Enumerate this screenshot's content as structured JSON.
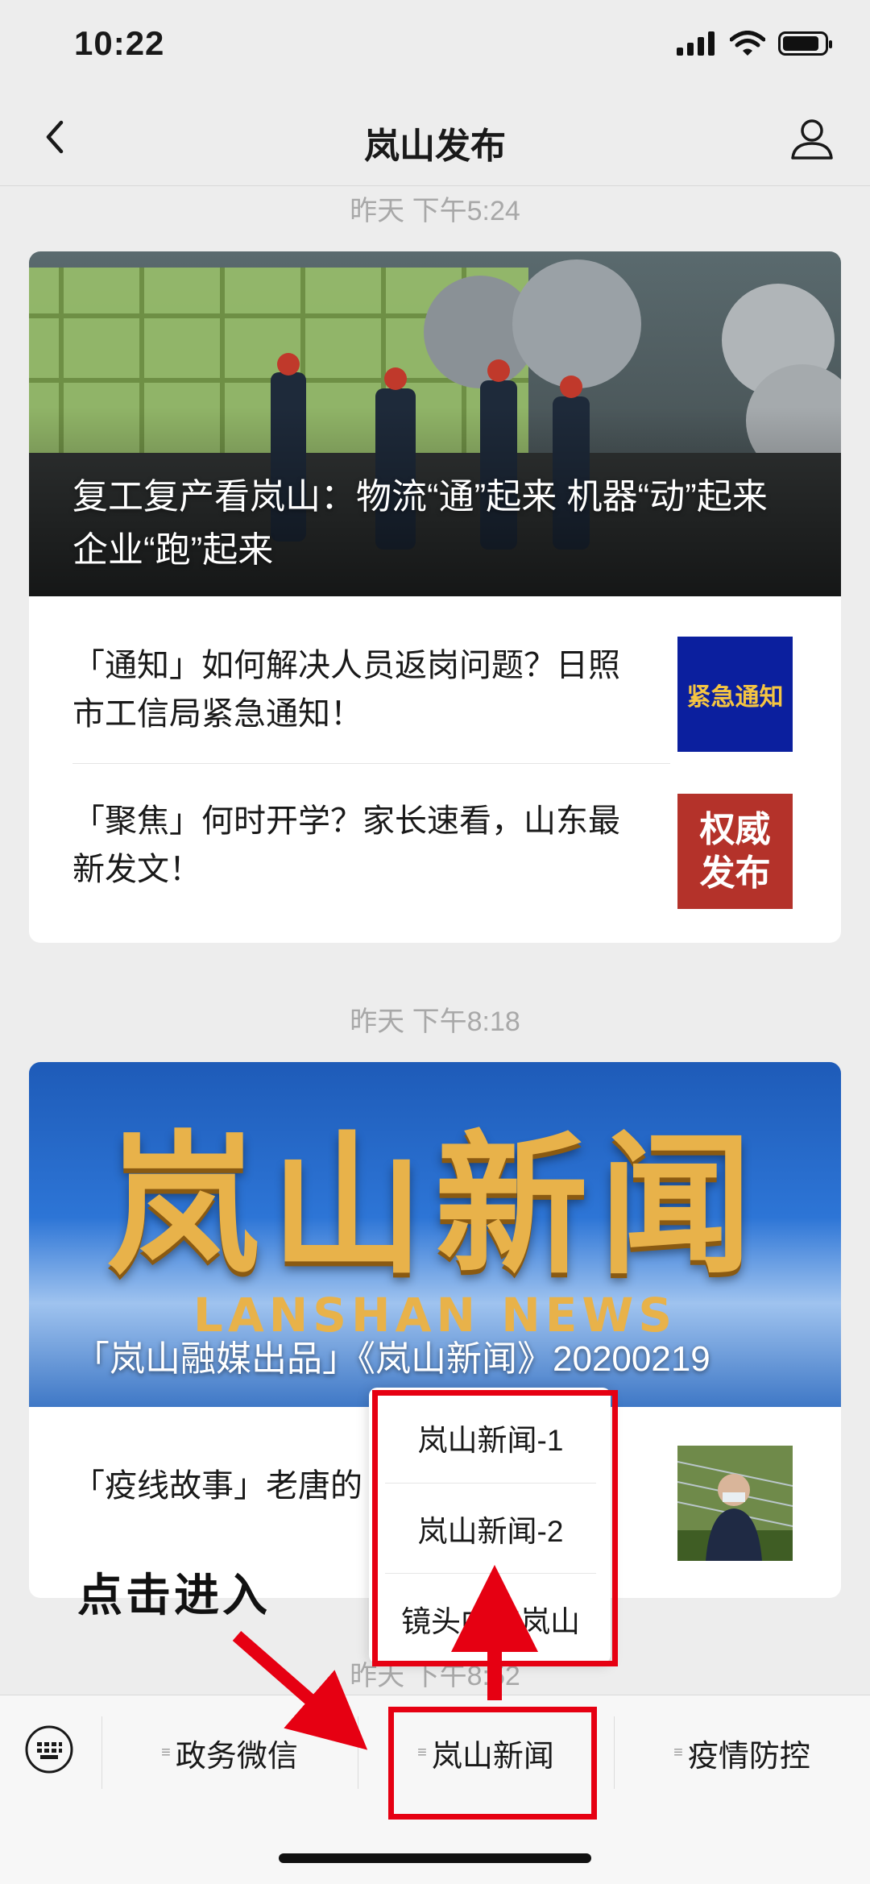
{
  "status": {
    "time": "10:22"
  },
  "nav": {
    "title": "岚山发布"
  },
  "feed": [
    {
      "time": "昨天 下午5:24",
      "hero_title": "复工复产看岚山：物流“通”起来 机器“动”起来 企业“跑”起来",
      "items": [
        {
          "text": "「通知」如何解决人员返岗问题？日照市工信局紧急通知！",
          "thumb_text": "紧急通知",
          "thumb_color": "#0b1f9e"
        },
        {
          "text": "「聚焦」何时开学？家长速看，山东最新发文！",
          "thumb_text": "权威发布",
          "thumb_color": "#b4322a"
        }
      ]
    },
    {
      "time": "昨天 下午8:18",
      "hero_banner_cn": "岚山新闻",
      "hero_banner_en": "LANSHAN NEWS",
      "hero_title": "「岚山融媒出品」《岚山新闻》20200219",
      "items": [
        {
          "text": "「疫线故事」老唐的"
        }
      ]
    }
  ],
  "next_time_partial": "昨天 下午8:52",
  "bottom_menu": [
    "政务微信",
    "岚山新闻",
    "疫情防控"
  ],
  "submenu": [
    "岚山新闻-1",
    "岚山新闻-2",
    "镜头中的岚山"
  ],
  "annotation": {
    "text": "点击进入",
    "color": "#e60012"
  }
}
